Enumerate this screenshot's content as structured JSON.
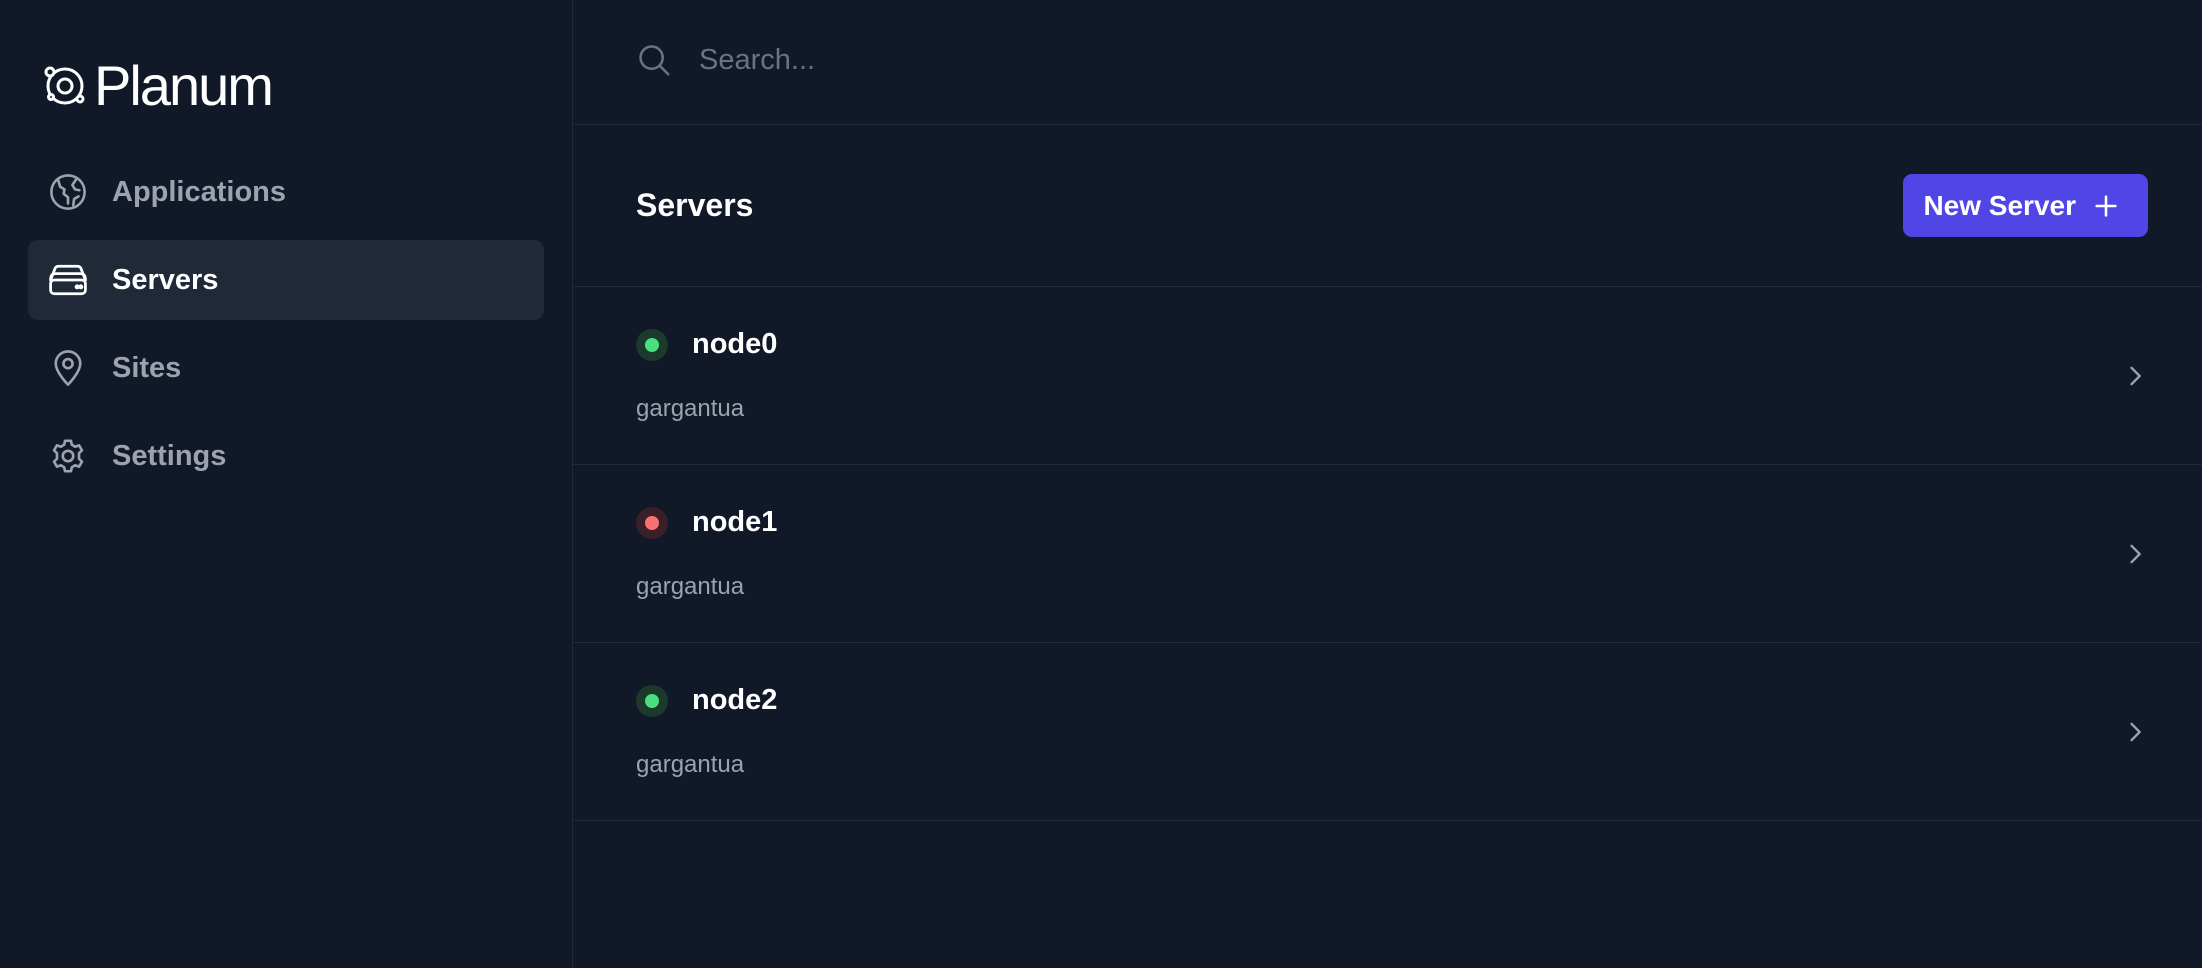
{
  "brand": {
    "name": "Planum"
  },
  "sidebar": {
    "items": [
      {
        "label": "Applications",
        "icon": "globe-icon",
        "active": false
      },
      {
        "label": "Servers",
        "icon": "server-icon",
        "active": true
      },
      {
        "label": "Sites",
        "icon": "map-pin-icon",
        "active": false
      },
      {
        "label": "Settings",
        "icon": "gear-icon",
        "active": false
      }
    ]
  },
  "search": {
    "placeholder": "Search...",
    "value": ""
  },
  "header": {
    "title": "Servers",
    "new_button_label": "New Server"
  },
  "servers": [
    {
      "name": "node0",
      "host": "gargantua",
      "status": "online"
    },
    {
      "name": "node1",
      "host": "gargantua",
      "status": "offline"
    },
    {
      "name": "node2",
      "host": "gargantua",
      "status": "online"
    }
  ],
  "colors": {
    "background": "#111827",
    "active_item": "#1f2937",
    "accent": "#4f46e5",
    "status_online": "#4ade80",
    "status_offline": "#f87171"
  }
}
